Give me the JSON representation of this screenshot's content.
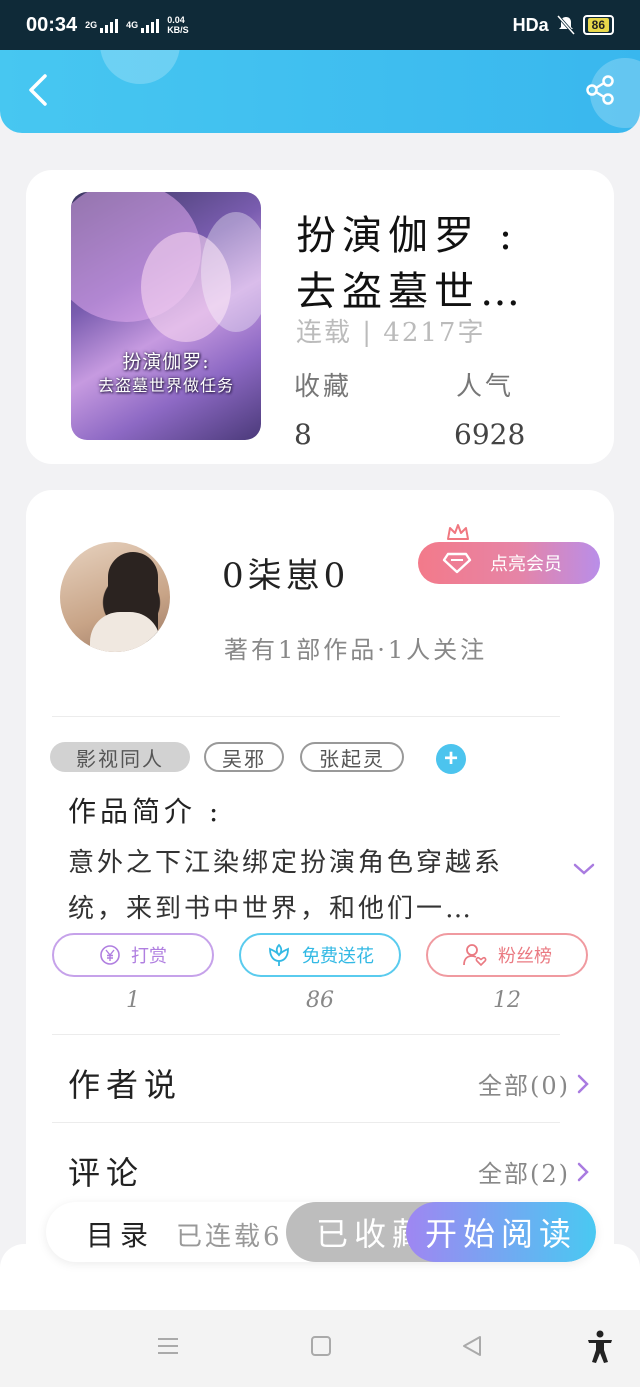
{
  "status_bar": {
    "time": "00:34",
    "signal1": "2G",
    "signal2": "4G",
    "net_speed_value": "0.04",
    "net_speed_unit": "KB/S",
    "hd": "HDa",
    "battery": "86"
  },
  "header": {
    "back_icon": "chevron-left-icon",
    "share_icon": "share-icon"
  },
  "book": {
    "cover_title_line1": "扮演伽罗:",
    "cover_title_line2": "去盗墓世界做任务",
    "title_line1": "扮演伽罗 :",
    "title_line2": "去盗墓世…",
    "status": "连载 | 4217字",
    "collect_label": "收藏",
    "collect_value": "8",
    "popularity_label": "人气",
    "popularity_value": "6928"
  },
  "author": {
    "name": "0柒崽0",
    "vip_label": "点亮会员",
    "works": "著有1部作品·1人关注"
  },
  "tags": [
    "影视同人",
    "吴邪",
    "张起灵"
  ],
  "intro": {
    "title": "作品简介 :",
    "text": "意外之下江染绑定扮演角色穿越系统，来到书中世界，和他们一…"
  },
  "actions": [
    {
      "label": "打赏",
      "count": "1",
      "color": "#c08ae6"
    },
    {
      "label": "免费送花",
      "count": "86",
      "color": "#3fc4e8"
    },
    {
      "label": "粉丝榜",
      "count": "12",
      "color": "#ef7f86"
    }
  ],
  "author_says": {
    "title": "作者说",
    "link": "全部(0)"
  },
  "comments": {
    "title": "评论",
    "link": "全部(2)"
  },
  "bottom_bar": {
    "toc": "目录",
    "status": "已连载6",
    "collected": "已收藏",
    "start": "开始阅读"
  },
  "colors": {
    "header": "#3fbff0",
    "accent_purple": "#a97be0",
    "accent_blue": "#4cc4ee"
  }
}
